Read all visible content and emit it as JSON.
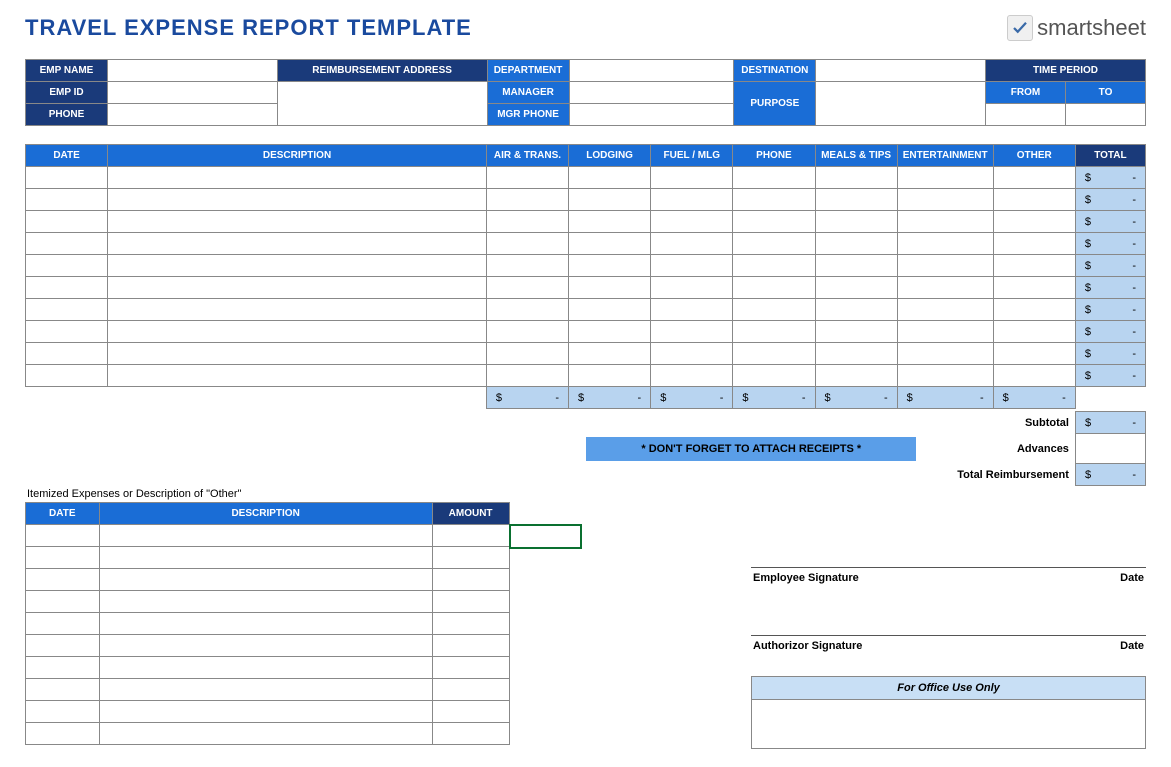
{
  "title": "TRAVEL EXPENSE REPORT TEMPLATE",
  "brand": "smartsheet",
  "info": {
    "emp_name": "EMP NAME",
    "reimb_addr": "REIMBURSEMENT ADDRESS",
    "department": "DEPARTMENT",
    "destination": "DESTINATION",
    "time_period": "TIME PERIOD",
    "emp_id": "EMP ID",
    "manager": "MANAGER",
    "purpose": "PURPOSE",
    "from": "FROM",
    "to": "TO",
    "phone": "PHONE",
    "mgr_phone": "MGR PHONE"
  },
  "main_headers": {
    "date": "DATE",
    "description": "DESCRIPTION",
    "air": "AIR & TRANS.",
    "lodging": "LODGING",
    "fuel": "FUEL / MLG",
    "phone": "PHONE",
    "meals": "MEALS & TIPS",
    "ent": "ENTERTAINMENT",
    "other": "OTHER",
    "total": "TOTAL"
  },
  "currency": "$",
  "dash": "-",
  "main_rows": 10,
  "summary": {
    "subtotal": "Subtotal",
    "advances": "Advances",
    "total_reimb": "Total Reimbursement"
  },
  "receipts_msg": "* DON'T FORGET TO ATTACH RECEIPTS *",
  "itemized_label": "Itemized Expenses or Description of \"Other\"",
  "item_headers": {
    "date": "DATE",
    "description": "DESCRIPTION",
    "amount": "AMOUNT"
  },
  "item_rows": 10,
  "sig": {
    "emp": "Employee Signature",
    "auth": "Authorizor Signature",
    "date": "Date"
  },
  "office": "For Office Use Only"
}
